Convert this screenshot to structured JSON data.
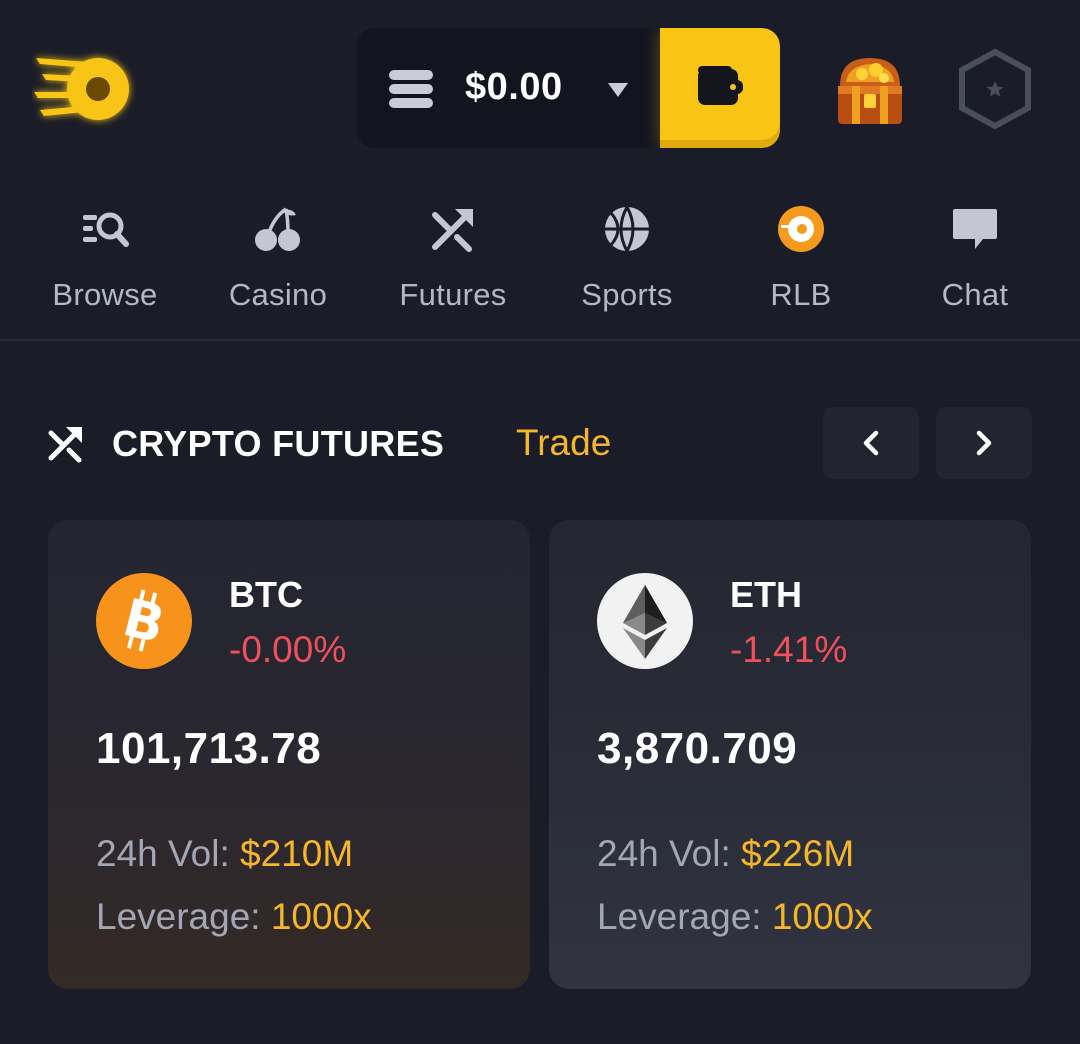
{
  "header": {
    "logo_icon": "rollbit-coin-logo-icon",
    "balance": "$0.00",
    "balance_icon": "coins-stack-icon",
    "dropdown_icon": "caret-down-icon",
    "wallet_icon": "wallet-icon",
    "rewards_icon": "treasure-chest-icon",
    "rank_icon": "hexagon-star-icon",
    "accent_color": "#f8c515"
  },
  "nav": {
    "items": [
      {
        "label": "Browse",
        "icon": "browse-search-icon"
      },
      {
        "label": "Casino",
        "icon": "cherries-icon"
      },
      {
        "label": "Futures",
        "icon": "futures-arrows-icon"
      },
      {
        "label": "Sports",
        "icon": "basketball-icon"
      },
      {
        "label": "RLB",
        "icon": "rlb-coin-icon"
      },
      {
        "label": "Chat",
        "icon": "chat-bubble-icon"
      }
    ]
  },
  "section": {
    "title": "CRYPTO FUTURES",
    "link": "Trade",
    "icon": "futures-arrows-icon",
    "prev_icon": "chevron-left-icon",
    "next_icon": "chevron-right-icon"
  },
  "cards": [
    {
      "symbol": "BTC",
      "change": "-0.00%",
      "price": "101,713.78",
      "vol_label": "24h Vol:",
      "vol_value": "$210M",
      "lev_label": "Leverage:",
      "lev_value": "1000x",
      "icon": "bitcoin-icon",
      "icon_color": "#f7931a"
    },
    {
      "symbol": "ETH",
      "change": "-1.41%",
      "price": "3,870.709",
      "vol_label": "24h Vol:",
      "vol_value": "$226M",
      "lev_label": "Leverage:",
      "lev_value": "1000x",
      "icon": "ethereum-icon",
      "icon_color": "#f2f2f2"
    }
  ],
  "colors": {
    "background": "#1a1c28",
    "negative": "#f0505a",
    "highlight": "#f5b62a"
  }
}
